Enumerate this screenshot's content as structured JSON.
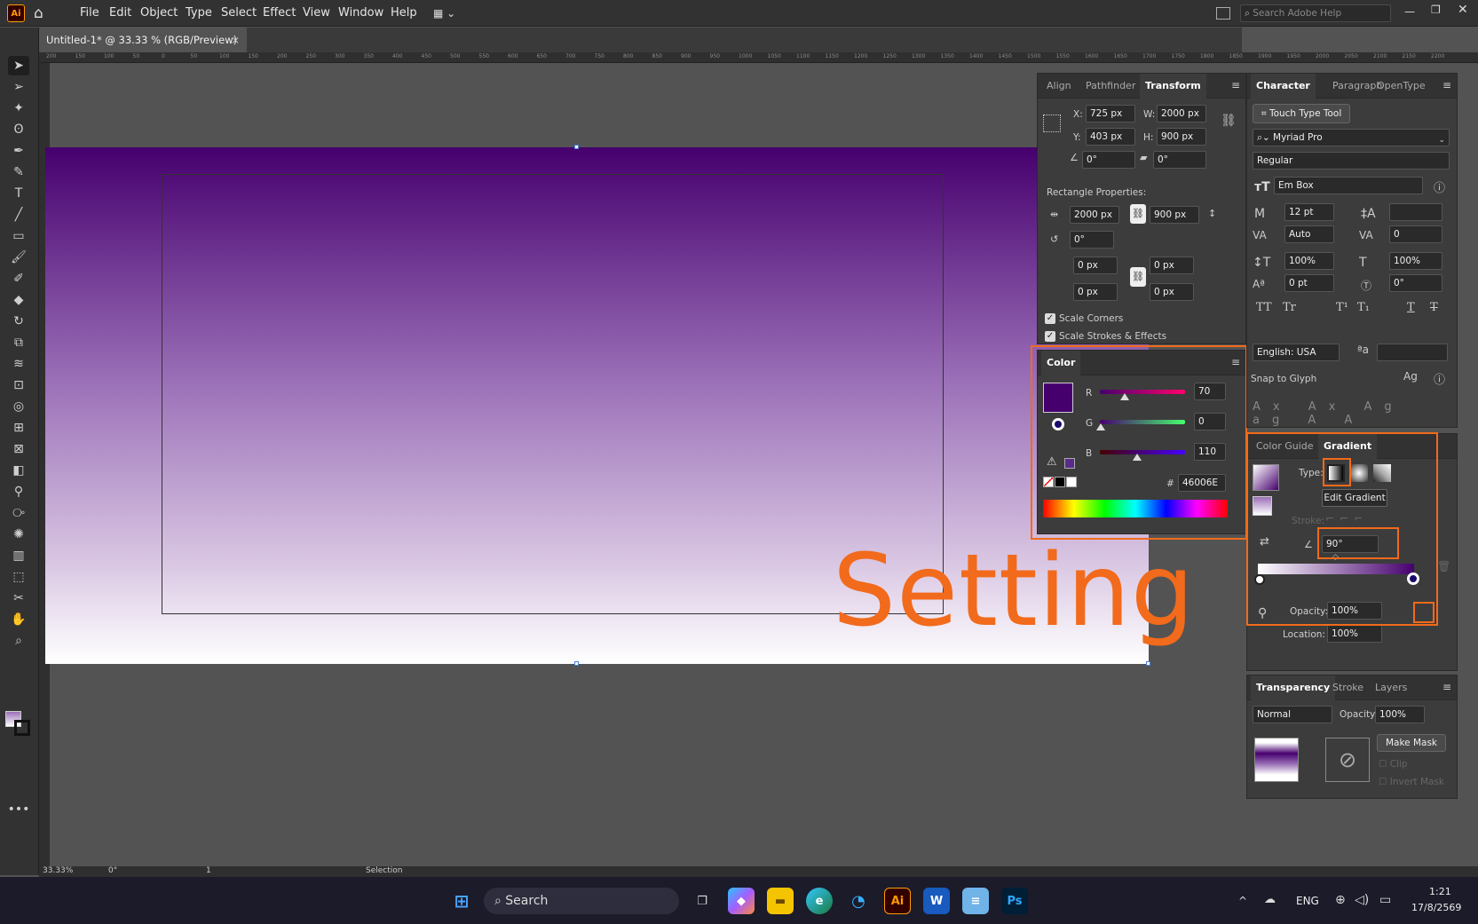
{
  "app": {
    "logo": "Ai",
    "search_placeholder": "Search Adobe Help"
  },
  "menu": [
    "File",
    "Edit",
    "Object",
    "Type",
    "Select",
    "Effect",
    "View",
    "Window",
    "Help"
  ],
  "doc_tab": {
    "title": "Untitled-1* @ 33.33 % (RGB/Preview)",
    "close": "×"
  },
  "ruler_ticks": [
    "200",
    "150",
    "100",
    "50",
    "0",
    "50",
    "100",
    "150",
    "200",
    "250",
    "300",
    "350",
    "400",
    "450",
    "500",
    "550",
    "600",
    "650",
    "700",
    "750",
    "800",
    "850",
    "900",
    "950",
    "1000",
    "1050",
    "1100",
    "1150",
    "1200",
    "1250",
    "1300",
    "1350",
    "1400",
    "1450",
    "1500",
    "1550",
    "1600",
    "1650",
    "1700",
    "1750",
    "1800",
    "1850",
    "1900",
    "1950",
    "2000",
    "2050",
    "2100",
    "2150",
    "2200"
  ],
  "overlay_text": "Setting",
  "transform": {
    "tabs": [
      "Align",
      "Pathfinder",
      "Transform"
    ],
    "x_label": "X:",
    "x": "725 px",
    "y_label": "Y:",
    "y": "403 px",
    "w_label": "W:",
    "w": "2000 px",
    "h_label": "H:",
    "h": "900 px",
    "rotate": "0°",
    "shear": "0°",
    "rect_props_label": "Rectangle Properties:",
    "rect_w": "2000 px",
    "rect_h": "900 px",
    "rect_angle": "0°",
    "corner_tl": "0 px",
    "corner_tr": "0 px",
    "corner_bl": "0 px",
    "corner_br": "0 px",
    "scale_corners": "Scale Corners",
    "scale_strokes": "Scale Strokes & Effects"
  },
  "color": {
    "title": "Color",
    "r_label": "R",
    "g_label": "G",
    "b_label": "B",
    "r": "70",
    "g": "0",
    "b": "110",
    "hash": "#",
    "hex": "46006E"
  },
  "character": {
    "tabs": [
      "Character",
      "Paragraph",
      "OpenType"
    ],
    "touch_type": "Touch Type Tool",
    "font": "Myriad Pro",
    "style": "Regular",
    "em_box": "Em Box",
    "size": "12 pt",
    "leading": "",
    "kerning": "Auto",
    "tracking": "0",
    "vscale": "100%",
    "hscale": "100%",
    "baseline": "0 pt",
    "rotation": "0°",
    "language": "English: USA",
    "snap": "Snap to Glyph",
    "aa": "a",
    "caps_buttons": [
      "TT",
      "Tr",
      "T¹",
      "T₁",
      "T",
      "T"
    ]
  },
  "gradient": {
    "tabs": [
      "Color Guide",
      "Gradient"
    ],
    "type_label": "Type:",
    "tooltip": "Edit Gradient",
    "stroke_label": "Stroke:",
    "angle": "90°",
    "opacity_label": "Opacity:",
    "opacity": "100%",
    "location_label": "Location:",
    "location": "100%"
  },
  "transparency": {
    "tabs": [
      "Transparency",
      "Stroke",
      "Layers"
    ],
    "blend": "Normal",
    "opacity_label": "Opacity:",
    "opacity": "100%",
    "make_mask": "Make Mask",
    "clip": "Clip",
    "invert": "Invert Mask"
  },
  "status": {
    "zoom": "33.33%",
    "rotate": "0°",
    "artboard": "1",
    "tool": "Selection"
  },
  "taskbar": {
    "search": "Search",
    "lang": "ENG",
    "time": "1:21",
    "date": "17/8/2569"
  },
  "colors": {
    "accent": "#F26A1B",
    "gradient_end": "#46006E"
  }
}
